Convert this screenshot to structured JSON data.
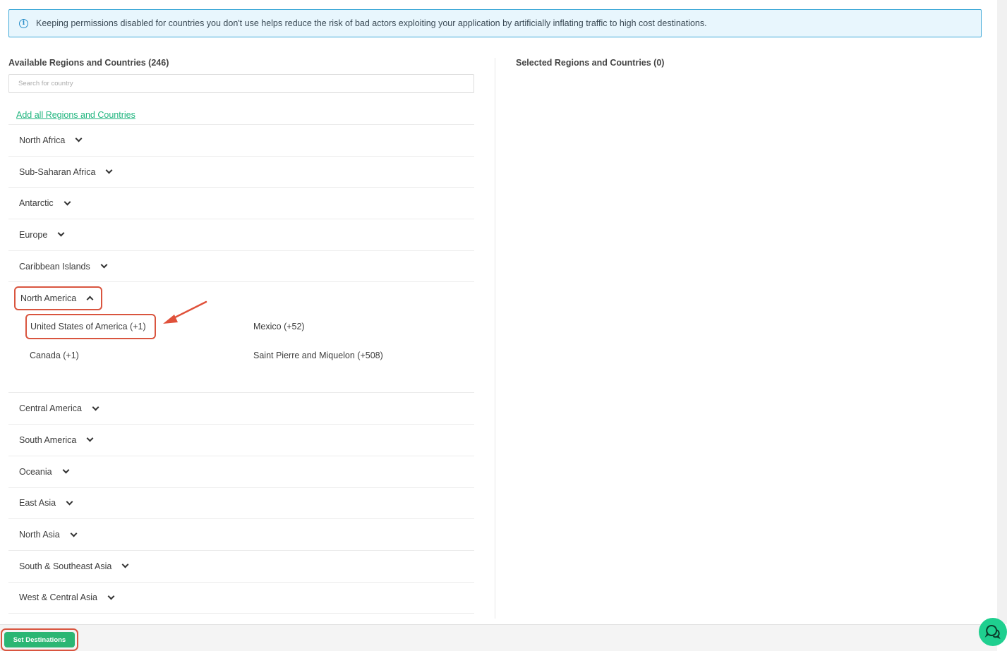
{
  "banner": {
    "icon": "info-icon",
    "text": "Keeping permissions disabled for countries you don't use helps reduce the risk of bad actors exploiting your application by artificially inflating traffic to high cost destinations."
  },
  "available": {
    "title": "Available Regions and Countries (246)",
    "search_placeholder": "Search for country",
    "add_all_label": "Add all Regions and Countries",
    "regions_before": [
      {
        "label": "North Africa"
      },
      {
        "label": "Sub-Saharan Africa"
      },
      {
        "label": "Antarctic"
      },
      {
        "label": "Europe"
      },
      {
        "label": "Caribbean Islands"
      }
    ],
    "expanded_region": {
      "label": "North America",
      "countries": [
        {
          "label": "United States of America (+1)"
        },
        {
          "label": "Mexico (+52)"
        },
        {
          "label": "Canada (+1)"
        },
        {
          "label": "Saint Pierre and Miquelon (+508)"
        }
      ]
    },
    "regions_after": [
      {
        "label": "Central America"
      },
      {
        "label": "South America"
      },
      {
        "label": "Oceania"
      },
      {
        "label": "East Asia"
      },
      {
        "label": "North Asia"
      },
      {
        "label": "South & Southeast Asia"
      },
      {
        "label": "West & Central Asia"
      }
    ]
  },
  "selected": {
    "title": "Selected Regions and Countries (0)"
  },
  "footer": {
    "set_destinations_label": "Set Destinations"
  },
  "colors": {
    "accent": "#2bb673",
    "link": "#1fb57e",
    "highlight": "#d9553f",
    "banner_bg": "#e8f6fd",
    "banner_border": "#3fa9d8"
  }
}
